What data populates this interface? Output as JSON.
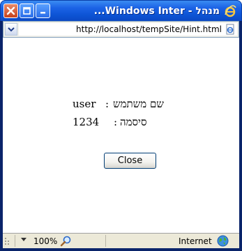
{
  "window": {
    "title": "...Windows Inter - מנהל",
    "titlebar_color": "#0b57d8",
    "close_color": "#cf4a22"
  },
  "address_bar": {
    "url": "http://localhost/tempSite/Hint.html"
  },
  "content": {
    "username_label": "שם משתמש",
    "username_sep": ":",
    "username_value": "user",
    "password_label": "סיסמה",
    "password_sep": ":",
    "password_value": "1234",
    "close_button_label": "Close"
  },
  "status_bar": {
    "zoom": "100%",
    "zone": "Internet"
  },
  "icons": [
    "close-icon",
    "maximize-icon",
    "minimize-icon",
    "ie-logo-icon",
    "chevron-down-icon",
    "page-icon",
    "magnifier-icon",
    "globe-icon",
    "resize-grip-icon"
  ]
}
